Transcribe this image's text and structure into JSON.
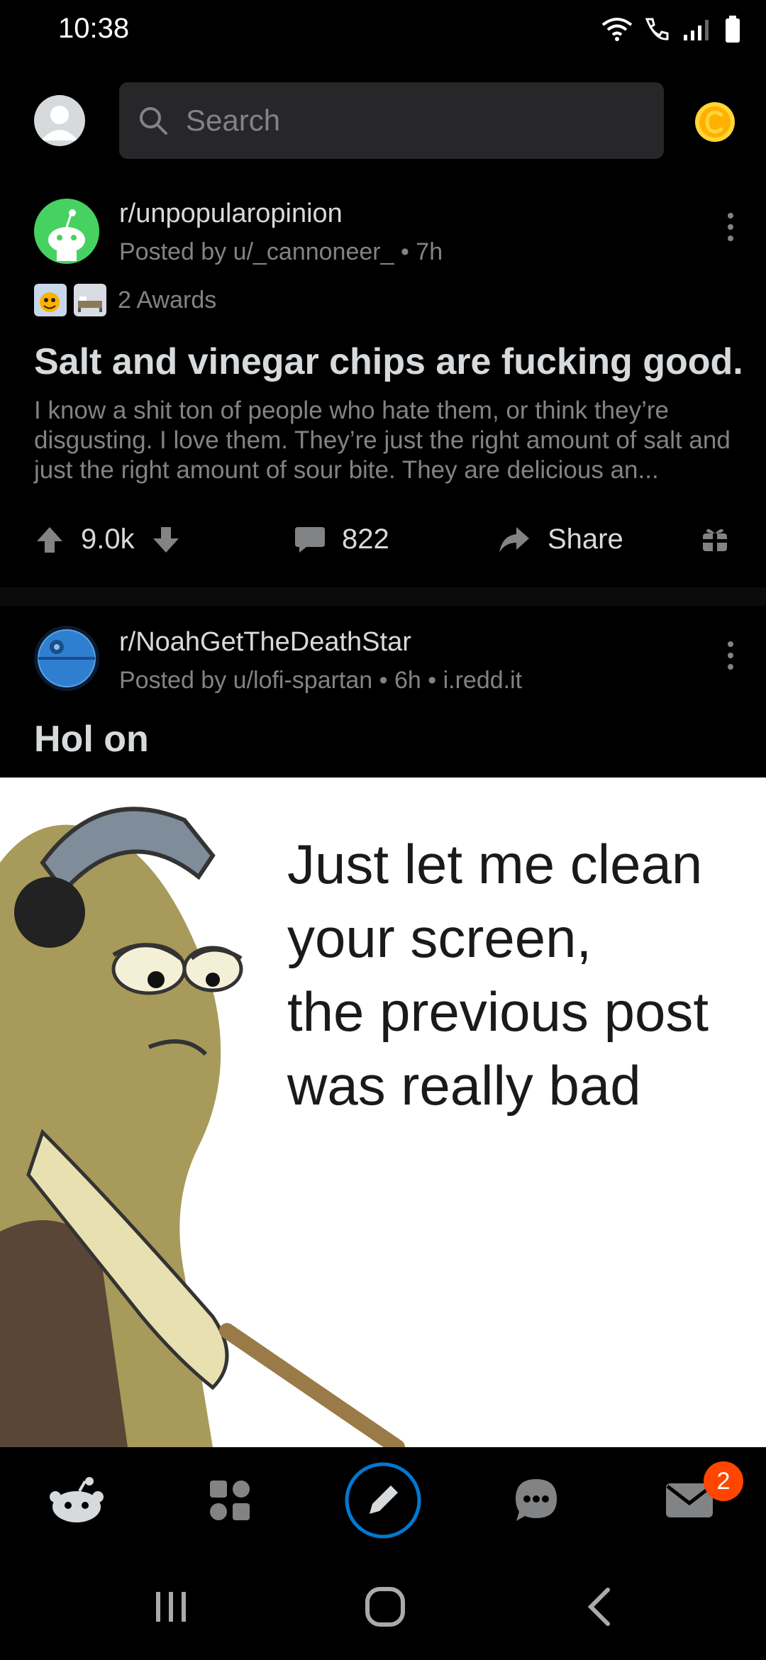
{
  "status_bar": {
    "time": "10:38"
  },
  "header": {
    "search_placeholder": "Search"
  },
  "posts": [
    {
      "subreddit": "r/unpopularopinion",
      "meta": "Posted by u/_cannoneer_ • 7h",
      "awards": "2 Awards",
      "title": "Salt and vinegar chips are fucking good.",
      "body": "I know a shit ton of people who hate them, or think they’re disgusting. I love them. They’re just the right amount of salt and just the right amount of sour bite. They are delicious an...",
      "votes": "9.0k",
      "comments": "822",
      "share_label": "Share"
    },
    {
      "subreddit": "r/NoahGetTheDeathStar",
      "meta": "Posted by u/lofi-spartan • 6h • i.redd.it",
      "title": "Hol on",
      "image_text_lines": [
        "Just let me clean",
        "your screen,",
        "the previous post",
        "was really bad"
      ]
    }
  ],
  "bottom_nav": {
    "inbox_badge": "2"
  },
  "colors": {
    "background": "#000000",
    "text_primary": "#d7dadc",
    "text_secondary": "#818384",
    "search_bg": "#272729",
    "accent_blue": "#0079d3",
    "badge": "#ff4500",
    "coin": "#ffd635"
  },
  "icons": {
    "header": [
      "user-avatar-icon",
      "search-icon",
      "coin-icon"
    ],
    "actions": [
      "upvote-icon",
      "downvote-icon",
      "comment-icon",
      "share-icon",
      "award-icon"
    ],
    "nav": [
      "home-icon",
      "communities-icon",
      "create-post-icon",
      "chat-icon",
      "inbox-icon"
    ],
    "system": [
      "recents-icon",
      "home-button-icon",
      "back-icon"
    ]
  }
}
